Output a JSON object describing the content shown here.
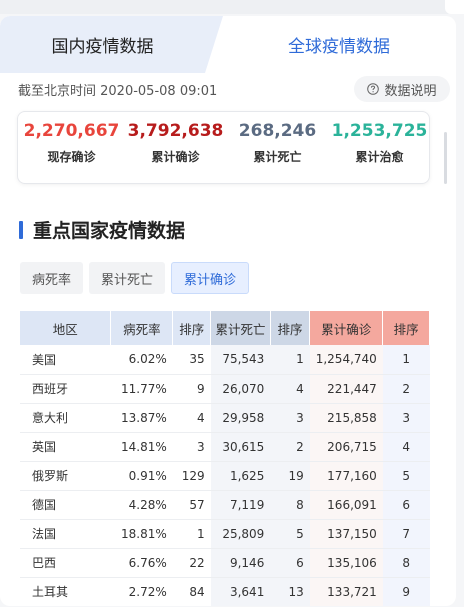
{
  "tabs": {
    "domestic": "国内疫情数据",
    "global": "全球疫情数据"
  },
  "update_time": "截至北京时间 2020-05-08 09:01",
  "info_button": {
    "label": "数据说明",
    "icon": "question-circle-icon"
  },
  "stats": [
    {
      "value": "2,270,667",
      "label": "现存确诊",
      "color": "#e8453c"
    },
    {
      "value": "3,792,638",
      "label": "累计确诊",
      "color": "#b71c1c"
    },
    {
      "value": "268,246",
      "label": "累计死亡",
      "color": "#5b6b82"
    },
    {
      "value": "1,253,725",
      "label": "累计治愈",
      "color": "#2bb39a"
    }
  ],
  "section": {
    "title": "重点国家疫情数据"
  },
  "sort_tabs": [
    "病死率",
    "累计死亡",
    "累计确诊"
  ],
  "sort_active": "累计确诊",
  "table": {
    "headers": [
      "地区",
      "病死率",
      "排序",
      "累计死亡",
      "排序",
      "累计确诊",
      "排序"
    ],
    "rows": [
      [
        "美国",
        "6.02%",
        "35",
        "75,543",
        "1",
        "1,254,740",
        "1"
      ],
      [
        "西班牙",
        "11.77%",
        "9",
        "26,070",
        "4",
        "221,447",
        "2"
      ],
      [
        "意大利",
        "13.87%",
        "4",
        "29,958",
        "3",
        "215,858",
        "3"
      ],
      [
        "英国",
        "14.81%",
        "3",
        "30,615",
        "2",
        "206,715",
        "4"
      ],
      [
        "俄罗斯",
        "0.91%",
        "129",
        "1,625",
        "19",
        "177,160",
        "5"
      ],
      [
        "德国",
        "4.28%",
        "57",
        "7,119",
        "8",
        "166,091",
        "6"
      ],
      [
        "法国",
        "18.81%",
        "1",
        "25,809",
        "5",
        "137,150",
        "7"
      ],
      [
        "巴西",
        "6.76%",
        "22",
        "9,146",
        "6",
        "135,106",
        "8"
      ],
      [
        "土耳其",
        "2.72%",
        "84",
        "3,641",
        "13",
        "133,721",
        "9"
      ]
    ]
  }
}
